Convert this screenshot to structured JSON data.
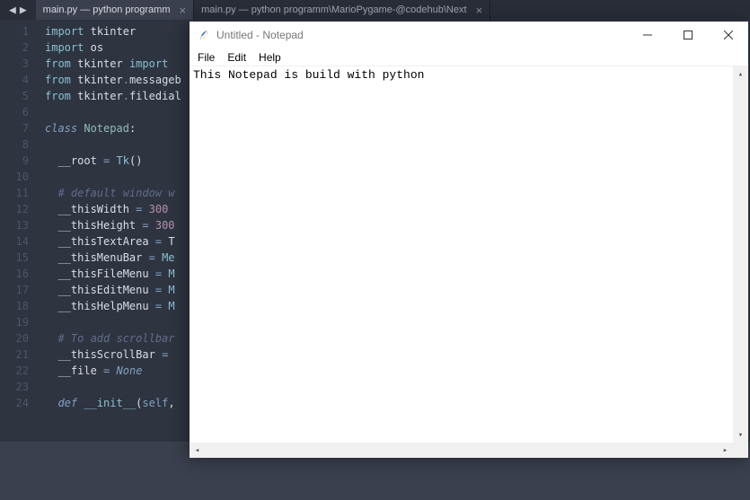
{
  "editor": {
    "tabs": [
      {
        "label": "main.py — python programm",
        "active": true
      },
      {
        "label": "main.py — python programm\\MarioPygame-@codehub\\Next",
        "active": false
      }
    ],
    "lines": [
      {
        "n": "1",
        "html": "<span class='kw'>import</span> <span class='txt'>tkinter</span>"
      },
      {
        "n": "2",
        "html": "<span class='kw'>import</span> <span class='txt'>os</span>"
      },
      {
        "n": "3",
        "html": "<span class='kw'>from</span> <span class='txt'>tkinter</span> <span class='kw'>import</span> "
      },
      {
        "n": "4",
        "html": "<span class='kw'>from</span> <span class='txt'>tkinter</span><span class='op'>.</span><span class='txt'>messageb</span>"
      },
      {
        "n": "5",
        "html": "<span class='kw'>from</span> <span class='txt'>tkinter</span><span class='op'>.</span><span class='txt'>filedial</span>"
      },
      {
        "n": "6",
        "html": ""
      },
      {
        "n": "7",
        "html": "<span class='kw3'>class</span> <span class='cls'>Notepad</span><span class='txt'>:</span>"
      },
      {
        "n": "8",
        "html": ""
      },
      {
        "n": "9",
        "html": "  <span class='txt'>__root</span> <span class='op'>=</span> <span class='fn'>Tk</span><span class='txt'>()</span>"
      },
      {
        "n": "10",
        "html": ""
      },
      {
        "n": "11",
        "html": "  <span class='com'># default window w</span>"
      },
      {
        "n": "12",
        "html": "  <span class='txt'>__thisWidth</span> <span class='op'>=</span> <span class='num'>300</span>"
      },
      {
        "n": "13",
        "html": "  <span class='txt'>__thisHeight</span> <span class='op'>=</span> <span class='num'>300</span>"
      },
      {
        "n": "14",
        "html": "  <span class='txt'>__thisTextArea</span> <span class='op'>=</span> <span class='txt'>T</span>"
      },
      {
        "n": "15",
        "html": "  <span class='txt'>__thisMenuBar</span> <span class='op'>=</span> <span class='fn'>Me</span>"
      },
      {
        "n": "16",
        "html": "  <span class='txt'>__thisFileMenu</span> <span class='op'>=</span> <span class='fn'>M</span>"
      },
      {
        "n": "17",
        "html": "  <span class='txt'>__thisEditMenu</span> <span class='op'>=</span> <span class='fn'>M</span>"
      },
      {
        "n": "18",
        "html": "  <span class='txt'>__thisHelpMenu</span> <span class='op'>=</span> <span class='fn'>M</span>"
      },
      {
        "n": "19",
        "html": ""
      },
      {
        "n": "20",
        "html": "  <span class='com'># To add scrollbar</span>"
      },
      {
        "n": "21",
        "html": "  <span class='txt'>__thisScrollBar</span> <span class='op'>=</span> "
      },
      {
        "n": "22",
        "html": "  <span class='txt'>__file</span> <span class='op'>=</span> <span class='none'>None</span>"
      },
      {
        "n": "23",
        "html": ""
      },
      {
        "n": "24",
        "html": "  <span class='def'>def</span> <span class='fn'>__init__</span><span class='txt'>(</span><span class='kw2'>self</span><span class='txt'>,</span>"
      }
    ]
  },
  "notepad": {
    "title": "Untitled - Notepad",
    "menus": {
      "file": "File",
      "edit": "Edit",
      "help": "Help"
    },
    "content": "This Notepad is build with python"
  }
}
